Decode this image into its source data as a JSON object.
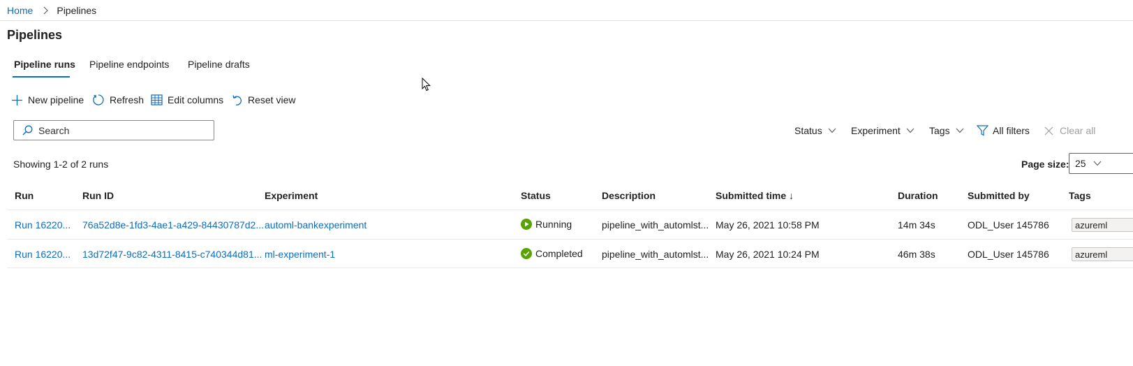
{
  "breadcrumb": {
    "home": "Home",
    "current": "Pipelines"
  },
  "page": {
    "title": "Pipelines"
  },
  "tabs": [
    {
      "label": "Pipeline runs",
      "active": true
    },
    {
      "label": "Pipeline endpoints",
      "active": false
    },
    {
      "label": "Pipeline drafts",
      "active": false
    }
  ],
  "toolbar": {
    "new_pipeline": "New pipeline",
    "refresh": "Refresh",
    "edit_columns": "Edit columns",
    "reset_view": "Reset view"
  },
  "search": {
    "placeholder": "Search",
    "value": ""
  },
  "filters": {
    "status": "Status",
    "experiment": "Experiment",
    "tags": "Tags",
    "all_filters": "All filters",
    "clear_all": "Clear all"
  },
  "summary": {
    "showing": "Showing 1-2 of 2 runs"
  },
  "page_size": {
    "label": "Page size:",
    "value": "25"
  },
  "table": {
    "columns": [
      "Run",
      "Run ID",
      "Experiment",
      "Status",
      "Description",
      "Submitted time ↓",
      "Duration",
      "Submitted by",
      "Tags"
    ],
    "rows": [
      {
        "run": "Run 16220...",
        "run_id": "76a52d8e-1fd3-4ae1-a429-84430787d2...",
        "experiment": "automl-bankexperiment",
        "status": "Running",
        "description": "pipeline_with_automlst...",
        "submitted_time": "May 26, 2021 10:58 PM",
        "duration": "14m 34s",
        "submitted_by": "ODL_User 145786",
        "tag": "azureml"
      },
      {
        "run": "Run 16220...",
        "run_id": "13d72f47-9c82-4311-8415-c740344d81...",
        "experiment": "ml-experiment-1",
        "status": "Completed",
        "description": "pipeline_with_automlst...",
        "submitted_time": "May 26, 2021 10:24 PM",
        "duration": "46m 38s",
        "submitted_by": "ODL_User 145786",
        "tag": "azureml"
      }
    ]
  },
  "colors": {
    "accent": "#0f6cbd",
    "status_green": "#57a300",
    "text": "#201f1e"
  }
}
